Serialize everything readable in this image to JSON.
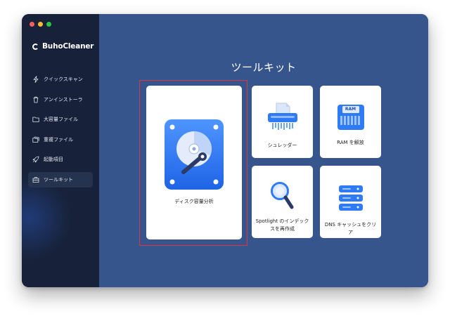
{
  "app": {
    "name": "BuhoCleaner"
  },
  "sidebar": {
    "items": [
      {
        "label": "クイックスキャン",
        "icon": "lightning-icon"
      },
      {
        "label": "アンインストーラ",
        "icon": "trash-icon"
      },
      {
        "label": "大容量ファイル",
        "icon": "folder-icon"
      },
      {
        "label": "重複ファイル",
        "icon": "duplicate-folder-icon"
      },
      {
        "label": "起動項目",
        "icon": "rocket-icon"
      },
      {
        "label": "ツールキット",
        "icon": "toolbox-icon",
        "active": true
      }
    ]
  },
  "main": {
    "title": "ツールキット",
    "tools": [
      {
        "label": "ディスク容量分析",
        "icon": "disk-analyzer-icon"
      },
      {
        "label": "シュレッダー",
        "icon": "shredder-icon"
      },
      {
        "label": "RAM を解放",
        "icon": "ram-icon",
        "icon_text": "RAM"
      },
      {
        "label": "Spotlight のインデックスを再作成",
        "icon": "magnifier-icon"
      },
      {
        "label": "DNS キャッシュをクリア",
        "icon": "dns-server-icon"
      }
    ]
  },
  "colors": {
    "sidebar_bg": "#17223a",
    "main_bg": "#36558c",
    "accent": "#2f7bf5",
    "highlight": "#e0343f"
  }
}
